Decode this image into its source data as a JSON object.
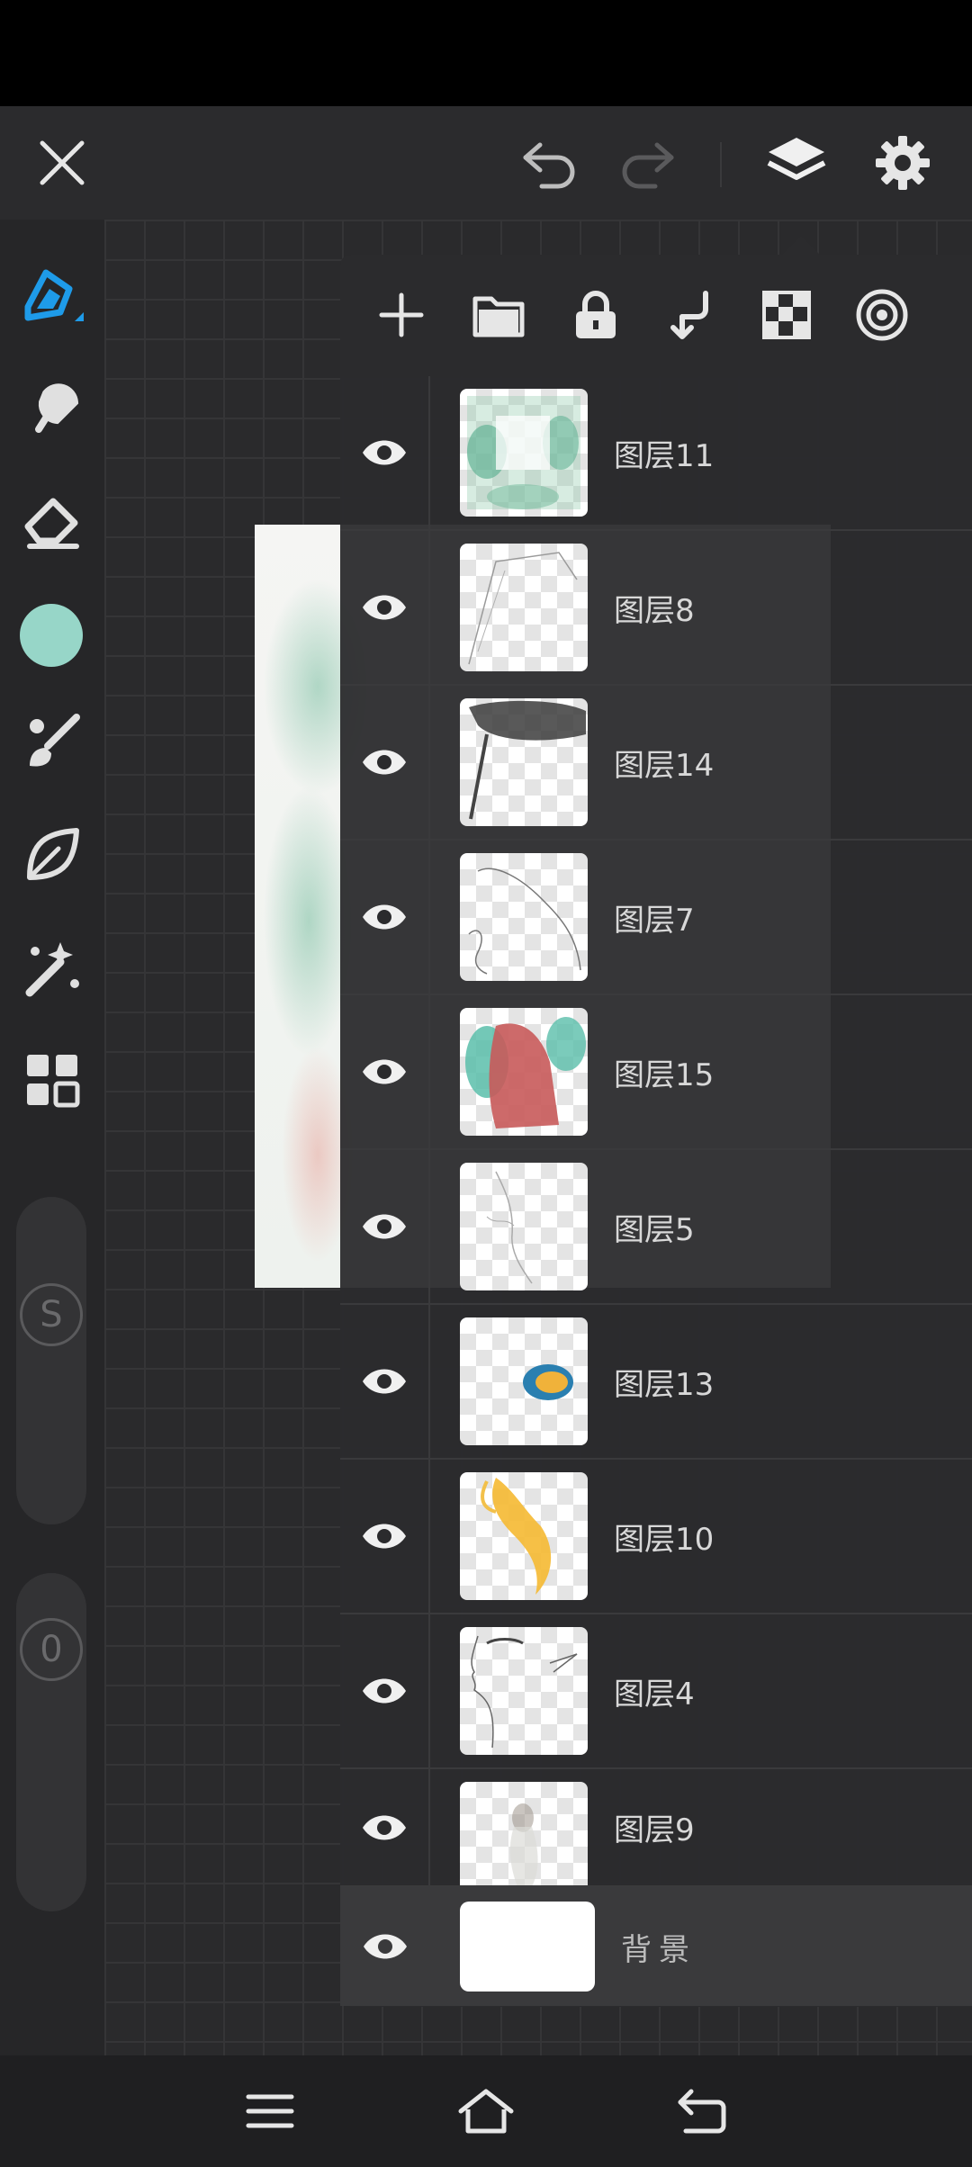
{
  "layers": [
    {
      "name": "图层11"
    },
    {
      "name": "图层8"
    },
    {
      "name": "图层14"
    },
    {
      "name": "图层7"
    },
    {
      "name": "图层15"
    },
    {
      "name": "图层5"
    },
    {
      "name": "图层13"
    },
    {
      "name": "图层10"
    },
    {
      "name": "图层4"
    },
    {
      "name": "图层9"
    }
  ],
  "background_layer": {
    "name": "背景"
  },
  "sliders": {
    "size_label": "S",
    "opacity_label": "0"
  },
  "colors": {
    "current_color": "#97d6c8",
    "accent": "#1e9be9"
  }
}
